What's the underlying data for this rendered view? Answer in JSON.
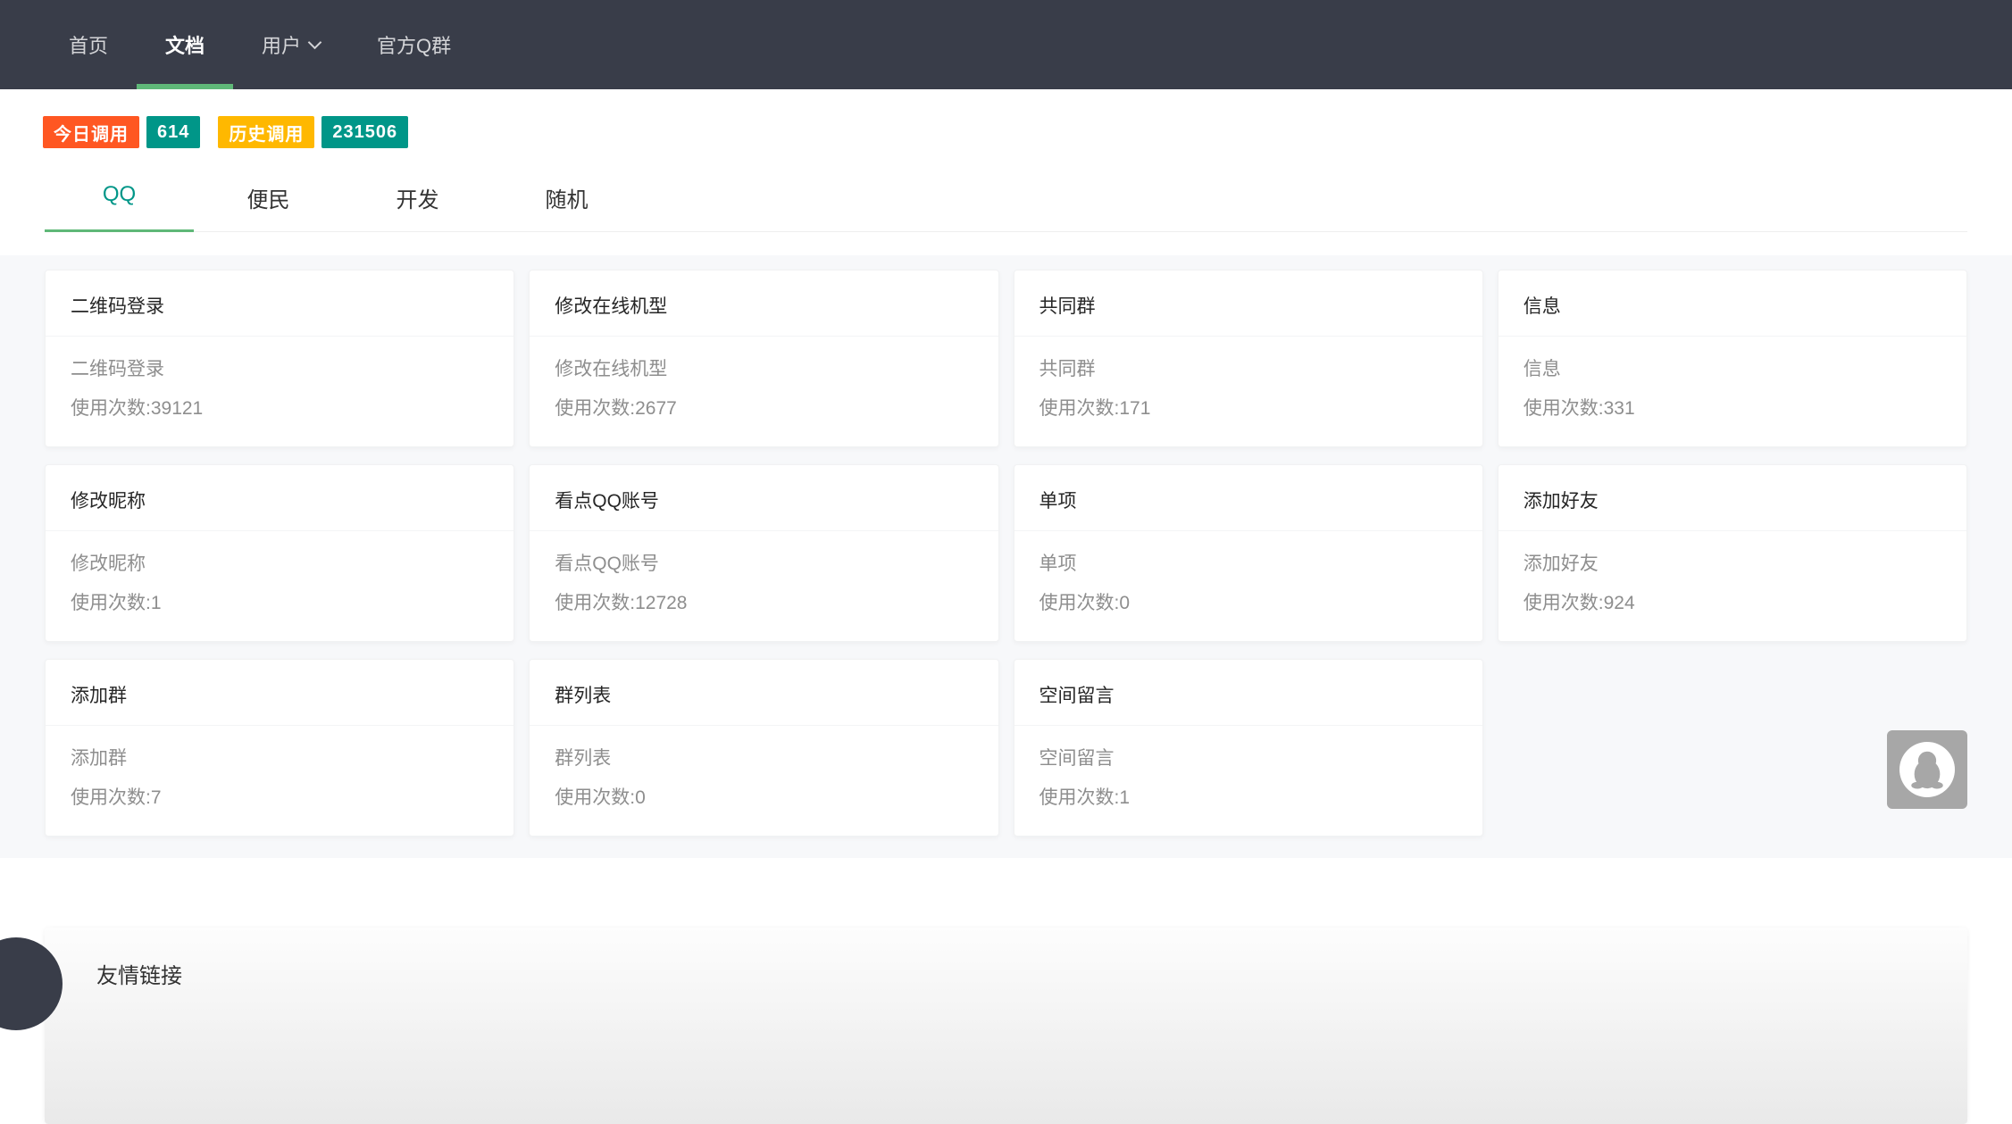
{
  "navbar": {
    "items": [
      {
        "label": "首页",
        "active": false,
        "dropdown": false
      },
      {
        "label": "文档",
        "active": true,
        "dropdown": false
      },
      {
        "label": "用户",
        "active": false,
        "dropdown": true
      },
      {
        "label": "官方Q群",
        "active": false,
        "dropdown": false
      }
    ]
  },
  "stats": {
    "badges": [
      {
        "text": "今日调用",
        "bg": "#FF5722",
        "gap_before": false
      },
      {
        "text": "614",
        "bg": "#009688",
        "gap_before": false
      },
      {
        "text": "历史调用",
        "bg": "#FFB800",
        "gap_before": true
      },
      {
        "text": "231506",
        "bg": "#009688",
        "gap_before": false
      }
    ]
  },
  "tabs": {
    "items": [
      {
        "label": "QQ",
        "active": true
      },
      {
        "label": "便民",
        "active": false
      },
      {
        "label": "开发",
        "active": false
      },
      {
        "label": "随机",
        "active": false
      }
    ]
  },
  "api_cards": [
    {
      "title": "二维码登录",
      "name": "二维码登录",
      "usage": "使用次数:39121"
    },
    {
      "title": "修改在线机型",
      "name": "修改在线机型",
      "usage": "使用次数:2677"
    },
    {
      "title": "共同群",
      "name": "共同群",
      "usage": "使用次数:171"
    },
    {
      "title": "信息",
      "name": "信息",
      "usage": "使用次数:331"
    },
    {
      "title": "修改昵称",
      "name": "修改昵称",
      "usage": "使用次数:1"
    },
    {
      "title": "看点QQ账号",
      "name": "看点QQ账号",
      "usage": "使用次数:12728"
    },
    {
      "title": "单项",
      "name": "单项",
      "usage": "使用次数:0"
    },
    {
      "title": "添加好友",
      "name": "添加好友",
      "usage": "使用次数:924"
    },
    {
      "title": "添加群",
      "name": "添加群",
      "usage": "使用次数:7"
    },
    {
      "title": "群列表",
      "name": "群列表",
      "usage": "使用次数:0"
    },
    {
      "title": "空间留言",
      "name": "空间留言",
      "usage": "使用次数:1"
    }
  ],
  "footer": {
    "title": "友情链接"
  },
  "colors": {
    "navbar_bg": "#393D49",
    "accent_green": "#5FB878",
    "accent_teal": "#009688",
    "badge_orange": "#FF5722",
    "badge_yellow": "#FFB800",
    "panel_bg": "#f7f8fa"
  }
}
